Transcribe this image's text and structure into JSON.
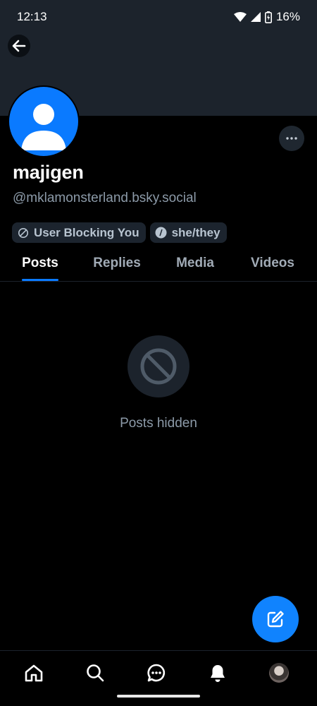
{
  "status_bar": {
    "time": "12:13",
    "battery": "16%"
  },
  "profile": {
    "display_name": "majigen",
    "handle": "@mklamonsterland.bsky.social",
    "pills": [
      {
        "label": "User Blocking You",
        "icon": "block-icon"
      },
      {
        "label": "she/they",
        "icon": "pronouns-icon"
      }
    ]
  },
  "tabs": [
    {
      "label": "Posts",
      "active": true
    },
    {
      "label": "Replies",
      "active": false
    },
    {
      "label": "Media",
      "active": false
    },
    {
      "label": "Videos",
      "active": false
    }
  ],
  "empty_state": {
    "icon": "block-icon",
    "text": "Posts hidden"
  },
  "bottom_nav": [
    "home-icon",
    "search-icon",
    "chat-icon",
    "bell-icon",
    "profile-avatar"
  ],
  "colors": {
    "accent": "#0a7aff",
    "background": "#000000",
    "banner": "#1c232c",
    "muted_text": "#8c9aa8"
  }
}
